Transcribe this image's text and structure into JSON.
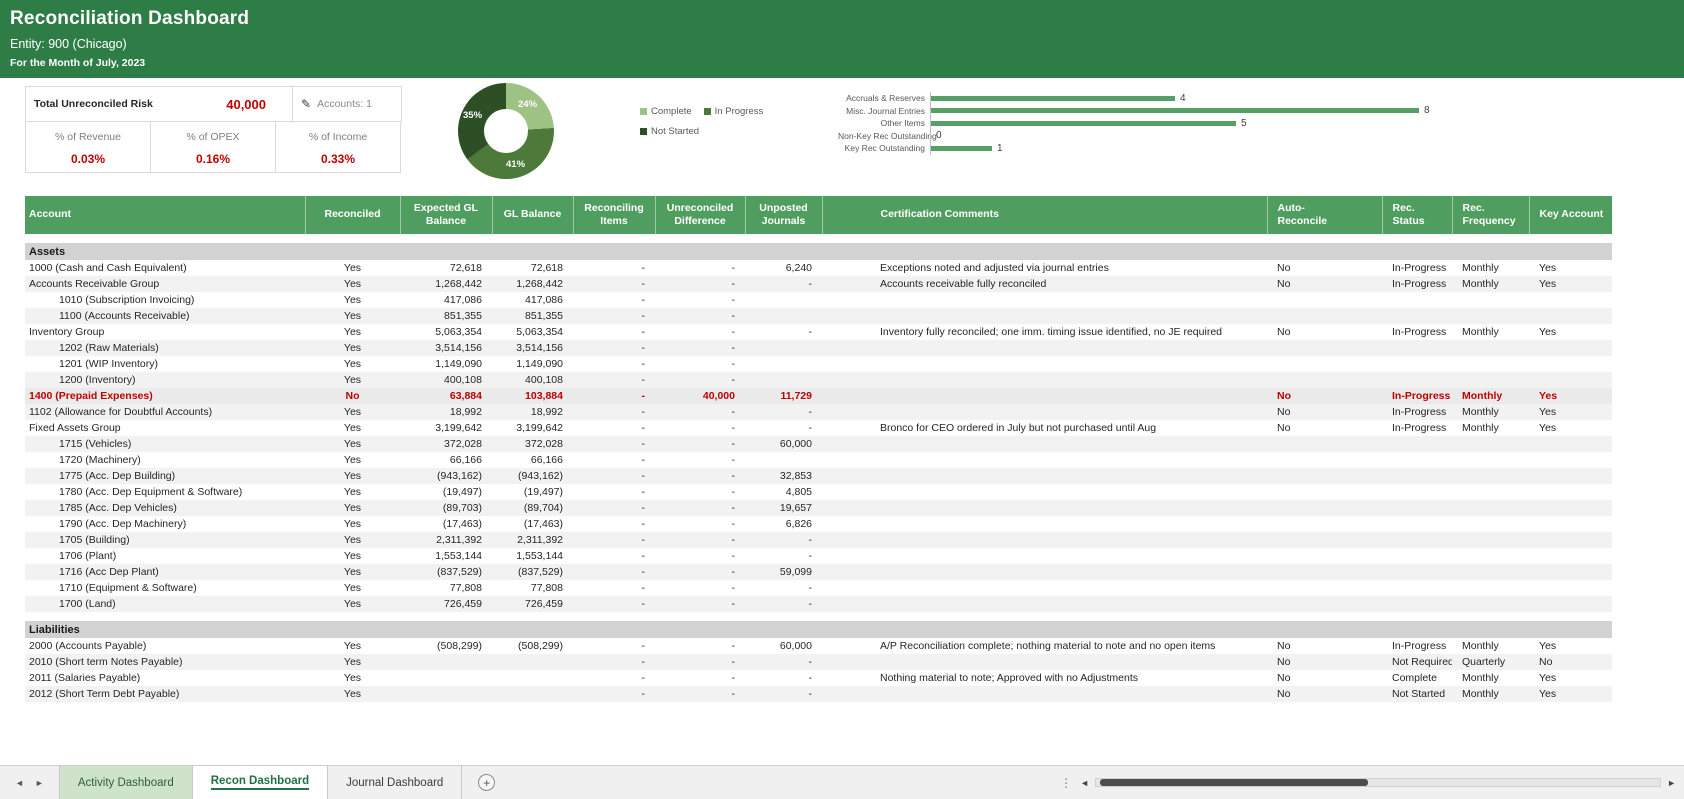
{
  "header": {
    "title": "Reconciliation Dashboard",
    "entity": "Entity: 900 (Chicago)",
    "period": "For the Month of July, 2023"
  },
  "kpis": {
    "risk_label": "Total Unreconciled Risk",
    "risk_value": "40,000",
    "accounts_label": "Accounts: 1",
    "cards": [
      {
        "label": "% of Revenue",
        "value": "0.03%"
      },
      {
        "label": "% of OPEX",
        "value": "0.16%"
      },
      {
        "label": "% of Income",
        "value": "0.33%"
      }
    ]
  },
  "colors": {
    "banner_green": "#2e7d46",
    "table_header_green": "#4f9e60",
    "alert_red": "#c00000",
    "bar_green": "#55a066"
  },
  "chart_data": [
    {
      "type": "pie",
      "subtype": "donut",
      "labels": [
        "Complete",
        "In Progress",
        "Not Started"
      ],
      "values": [
        24,
        41,
        35
      ],
      "unit": "%",
      "colors": [
        "#9dc284",
        "#4d7a3a",
        "#2d4f26"
      ],
      "legend_position": "right"
    },
    {
      "type": "bar",
      "orientation": "horizontal",
      "categories": [
        "Accruals & Reserves",
        "Misc. Journal Entries",
        "Other Items",
        "Non-Key Rec Outstanding",
        "Key Rec Outstanding"
      ],
      "values": [
        4,
        8,
        5,
        0,
        1
      ],
      "xlim": [
        0,
        8
      ],
      "color": "#55a066",
      "grid": false,
      "legend_position": "none"
    }
  ],
  "table": {
    "columns": [
      {
        "key": "account",
        "label": "Account",
        "align": "left"
      },
      {
        "key": "reconciled",
        "label": "Reconciled",
        "align": "center"
      },
      {
        "key": "expected_gl_balance",
        "label": "Expected GL\nBalance",
        "align": "center"
      },
      {
        "key": "gl_balance",
        "label": "GL Balance",
        "align": "center"
      },
      {
        "key": "reconciling_items",
        "label": "Reconciling\nItems",
        "align": "center"
      },
      {
        "key": "unreconciled_difference",
        "label": "Unreconciled\nDifference",
        "align": "center"
      },
      {
        "key": "unposted_journals",
        "label": "Unposted\nJournals",
        "align": "center"
      },
      {
        "key": "certification_comments",
        "label": "Certification Comments",
        "align": "left"
      },
      {
        "key": "auto_reconcile",
        "label": "Auto-\nReconcile",
        "align": "left"
      },
      {
        "key": "rec_status",
        "label": "Rec.\nStatus",
        "align": "left"
      },
      {
        "key": "rec_frequency",
        "label": "Rec.\nFrequency",
        "align": "left"
      },
      {
        "key": "key_account",
        "label": "Key Account",
        "align": "left"
      }
    ],
    "sections": [
      {
        "title": "Assets",
        "rows": [
          {
            "account": "1000 (Cash and Cash Equivalent)",
            "reconciled": "Yes",
            "expected": "72,618",
            "gl": "72,618",
            "reconciling": "-",
            "unreconciled": "-",
            "unposted": "6,240",
            "comments": "Exceptions noted and adjusted via journal entries",
            "auto": "No",
            "status": "In-Progress",
            "freq": "Monthly",
            "key": "Yes"
          },
          {
            "account": "Accounts Receivable Group",
            "reconciled": "Yes",
            "expected": "1,268,442",
            "gl": "1,268,442",
            "reconciling": "-",
            "unreconciled": "-",
            "unposted": "-",
            "comments": "Accounts receivable fully reconciled",
            "auto": "No",
            "status": "In-Progress",
            "freq": "Monthly",
            "key": "Yes"
          },
          {
            "account": "1010 (Subscription Invoicing)",
            "indent": true,
            "reconciled": "Yes",
            "expected": "417,086",
            "gl": "417,086",
            "reconciling": "-",
            "unreconciled": "-"
          },
          {
            "account": "1100 (Accounts Receivable)",
            "indent": true,
            "reconciled": "Yes",
            "expected": "851,355",
            "gl": "851,355",
            "reconciling": "-",
            "unreconciled": "-"
          },
          {
            "account": "Inventory Group",
            "reconciled": "Yes",
            "expected": "5,063,354",
            "gl": "5,063,354",
            "reconciling": "-",
            "unreconciled": "-",
            "unposted": "-",
            "comments": "Inventory fully reconciled; one imm. timing issue identified, no JE required",
            "auto": "No",
            "status": "In-Progress",
            "freq": "Monthly",
            "key": "Yes"
          },
          {
            "account": "1202 (Raw Materials)",
            "indent": true,
            "reconciled": "Yes",
            "expected": "3,514,156",
            "gl": "3,514,156",
            "reconciling": "-",
            "unreconciled": "-"
          },
          {
            "account": "1201 (WIP Inventory)",
            "indent": true,
            "reconciled": "Yes",
            "expected": "1,149,090",
            "gl": "1,149,090",
            "reconciling": "-",
            "unreconciled": "-"
          },
          {
            "account": "1200 (Inventory)",
            "indent": true,
            "reconciled": "Yes",
            "expected": "400,108",
            "gl": "400,108",
            "reconciling": "-",
            "unreconciled": "-"
          },
          {
            "account": "1400 (Prepaid Expenses)",
            "highlight": true,
            "reconciled": "No",
            "expected": "63,884",
            "gl": "103,884",
            "reconciling": "-",
            "unreconciled": "40,000",
            "unposted": "11,729",
            "comments": "",
            "auto": "No",
            "status": "In-Progress",
            "freq": "Monthly",
            "key": "Yes"
          },
          {
            "account": "1102 (Allowance for Doubtful Accounts)",
            "reconciled": "Yes",
            "expected": "18,992",
            "gl": "18,992",
            "reconciling": "-",
            "unreconciled": "-",
            "unposted": "-",
            "auto": "No",
            "status": "In-Progress",
            "freq": "Monthly",
            "key": "Yes"
          },
          {
            "account": "Fixed Assets Group",
            "reconciled": "Yes",
            "expected": "3,199,642",
            "gl": "3,199,642",
            "reconciling": "-",
            "unreconciled": "-",
            "unposted": "-",
            "comments": "Bronco for CEO ordered in July but not purchased until Aug",
            "auto": "No",
            "status": "In-Progress",
            "freq": "Monthly",
            "key": "Yes"
          },
          {
            "account": "1715 (Vehicles)",
            "indent": true,
            "reconciled": "Yes",
            "expected": "372,028",
            "gl": "372,028",
            "reconciling": "-",
            "unreconciled": "-",
            "unposted": "60,000"
          },
          {
            "account": "1720 (Machinery)",
            "indent": true,
            "reconciled": "Yes",
            "expected": "66,166",
            "gl": "66,166",
            "reconciling": "-",
            "unreconciled": "-"
          },
          {
            "account": "1775 (Acc. Dep Building)",
            "indent": true,
            "reconciled": "Yes",
            "expected": "(943,162)",
            "gl": "(943,162)",
            "reconciling": "-",
            "unreconciled": "-",
            "unposted": "32,853"
          },
          {
            "account": "1780 (Acc. Dep Equipment & Software)",
            "indent": true,
            "reconciled": "Yes",
            "expected": "(19,497)",
            "gl": "(19,497)",
            "reconciling": "-",
            "unreconciled": "-",
            "unposted": "4,805"
          },
          {
            "account": "1785 (Acc. Dep Vehicles)",
            "indent": true,
            "reconciled": "Yes",
            "expected": "(89,703)",
            "gl": "(89,704)",
            "reconciling": "-",
            "unreconciled": "-",
            "unposted": "19,657"
          },
          {
            "account": "1790 (Acc. Dep Machinery)",
            "indent": true,
            "reconciled": "Yes",
            "expected": "(17,463)",
            "gl": "(17,463)",
            "reconciling": "-",
            "unreconciled": "-",
            "unposted": "6,826"
          },
          {
            "account": "1705 (Building)",
            "indent": true,
            "reconciled": "Yes",
            "expected": "2,311,392",
            "gl": "2,311,392",
            "reconciling": "-",
            "unreconciled": "-",
            "unposted": "-"
          },
          {
            "account": "1706 (Plant)",
            "indent": true,
            "reconciled": "Yes",
            "expected": "1,553,144",
            "gl": "1,553,144",
            "reconciling": "-",
            "unreconciled": "-",
            "unposted": "-"
          },
          {
            "account": "1716 (Acc Dep Plant)",
            "indent": true,
            "reconciled": "Yes",
            "expected": "(837,529)",
            "gl": "(837,529)",
            "reconciling": "-",
            "unreconciled": "-",
            "unposted": "59,099"
          },
          {
            "account": "1710 (Equipment & Software)",
            "indent": true,
            "reconciled": "Yes",
            "expected": "77,808",
            "gl": "77,808",
            "reconciling": "-",
            "unreconciled": "-",
            "unposted": "-"
          },
          {
            "account": "1700 (Land)",
            "indent": true,
            "reconciled": "Yes",
            "expected": "726,459",
            "gl": "726,459",
            "reconciling": "-",
            "unreconciled": "-",
            "unposted": "-"
          }
        ]
      },
      {
        "title": "Liabilities",
        "rows": [
          {
            "account": "2000 (Accounts Payable)",
            "reconciled": "Yes",
            "expected": "(508,299)",
            "gl": "(508,299)",
            "reconciling": "-",
            "unreconciled": "-",
            "unposted": "60,000",
            "comments": "A/P Reconciliation complete; nothing material to note and no open items",
            "auto": "No",
            "status": "In-Progress",
            "freq": "Monthly",
            "key": "Yes"
          },
          {
            "account": "2010 (Short term Notes Payable)",
            "reconciled": "Yes",
            "reconciling": "-",
            "unreconciled": "-",
            "unposted": "-",
            "auto": "No",
            "status": "Not Required",
            "freq": "Quarterly",
            "key": "No"
          },
          {
            "account": "2011 (Salaries Payable)",
            "reconciled": "Yes",
            "reconciling": "-",
            "unreconciled": "-",
            "unposted": "-",
            "comments": "Nothing material to note; Approved with no Adjustments",
            "auto": "No",
            "status": "Complete",
            "freq": "Monthly",
            "key": "Yes"
          },
          {
            "account": "2012 (Short Term Debt Payable)",
            "reconciled": "Yes",
            "reconciling": "-",
            "unreconciled": "-",
            "unposted": "-",
            "auto": "No",
            "status": "Not Started",
            "freq": "Monthly",
            "key": "Yes"
          }
        ]
      }
    ]
  },
  "sheet_bar": {
    "tabs": [
      {
        "label": "Activity Dashboard",
        "state": "colored"
      },
      {
        "label": "Recon Dashboard",
        "state": "active"
      },
      {
        "label": "Journal Dashboard",
        "state": "default"
      }
    ],
    "add_label": "+"
  },
  "icons": {
    "pencil": "pencil-icon",
    "add_sheet": "add-sheet-icon",
    "nav_left": "chevron-left-icon",
    "nav_right": "chevron-right-icon"
  }
}
